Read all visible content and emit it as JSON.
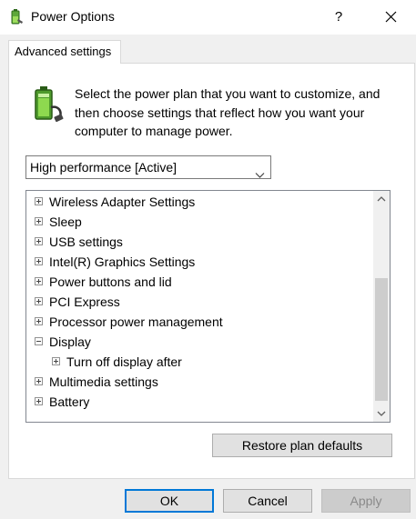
{
  "window": {
    "title": "Power Options",
    "help_label": "?",
    "icon": "power-options-icon",
    "close_icon": "close-icon"
  },
  "tab": {
    "label": "Advanced settings"
  },
  "description": {
    "text": "Select the power plan that you want to customize, and then choose settings that reflect how you want your computer to manage power.",
    "icon": "battery-plug-icon"
  },
  "plan_select": {
    "value": "High performance [Active]",
    "icon": "chevron-down-icon"
  },
  "tree": {
    "items": [
      {
        "label": "Wireless Adapter Settings",
        "expander": "plus",
        "level": 0
      },
      {
        "label": "Sleep",
        "expander": "plus",
        "level": 0
      },
      {
        "label": "USB settings",
        "expander": "plus",
        "level": 0
      },
      {
        "label": "Intel(R) Graphics Settings",
        "expander": "plus",
        "level": 0
      },
      {
        "label": "Power buttons and lid",
        "expander": "plus",
        "level": 0
      },
      {
        "label": "PCI Express",
        "expander": "plus",
        "level": 0
      },
      {
        "label": "Processor power management",
        "expander": "plus",
        "level": 0
      },
      {
        "label": "Display",
        "expander": "minus",
        "level": 0
      },
      {
        "label": "Turn off display after",
        "expander": "plus",
        "level": 1
      },
      {
        "label": "Multimedia settings",
        "expander": "plus",
        "level": 0
      },
      {
        "label": "Battery",
        "expander": "plus",
        "level": 0
      }
    ]
  },
  "buttons": {
    "restore": "Restore plan defaults",
    "ok": "OK",
    "cancel": "Cancel",
    "apply": "Apply"
  },
  "colors": {
    "accent": "#0078d7",
    "battery_green": "#6abf2e",
    "disabled_text": "#8a8a8a"
  }
}
